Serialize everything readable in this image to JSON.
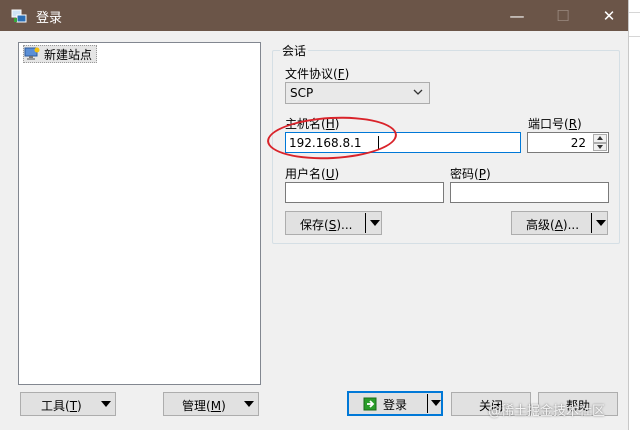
{
  "window": {
    "title": "登录",
    "minimize": "—",
    "maximize": "☐",
    "close": "✕"
  },
  "tree": {
    "items": [
      {
        "label": "新建站点"
      }
    ]
  },
  "session": {
    "group_title": "会话",
    "protocol_label": "文件协议",
    "protocol_key": "F",
    "protocol_value": "SCP",
    "host_label": "主机名",
    "host_key": "H",
    "host_value": "192.168.8.1",
    "port_label": "端口号",
    "port_key": "R",
    "port_value": "22",
    "user_label": "用户名",
    "user_key": "U",
    "user_value": "",
    "password_label": "密码",
    "password_key": "P",
    "password_value": "",
    "save_label": "保存",
    "save_key": "S",
    "save_suffix": "...",
    "advanced_label": "高级",
    "advanced_key": "A",
    "advanced_suffix": "..."
  },
  "bottom": {
    "tools_label": "工具",
    "tools_key": "T",
    "manage_label": "管理",
    "manage_key": "M",
    "login_label": "登录",
    "close_label": "关闭",
    "help_label": "帮助"
  },
  "watermark": "@稀土掘金技术社区",
  "colors": {
    "titlebar": "#6b5548",
    "accent": "#0078d7",
    "annotation": "#d9232a",
    "login_icon": "#2a9d2a"
  }
}
